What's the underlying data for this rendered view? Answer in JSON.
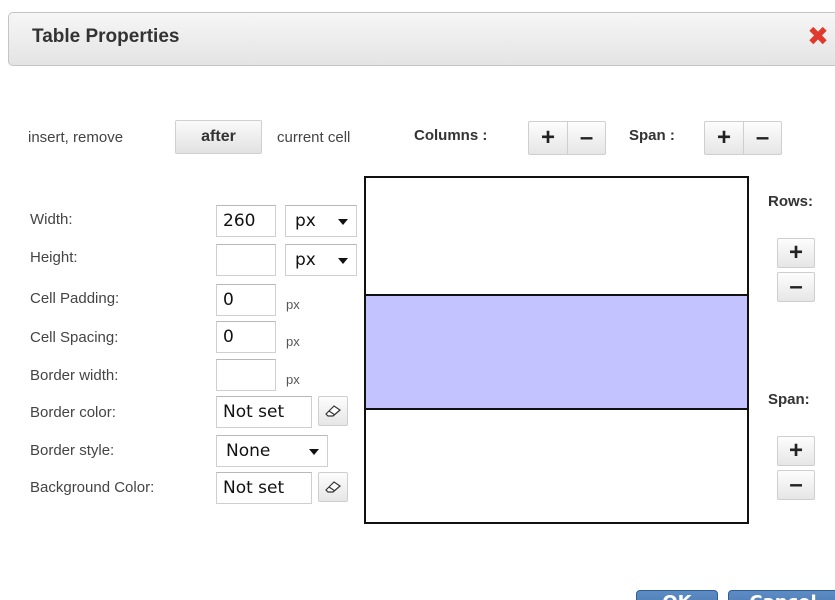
{
  "dialog": {
    "title": "Table Properties",
    "close_icon": "close-icon"
  },
  "cell_bar": {
    "prefix": "insert, remove",
    "after_button": "after",
    "suffix": "current cell",
    "columns_label": "Columns :",
    "span_label": "Span :",
    "plus": "+",
    "minus": "–"
  },
  "fields": {
    "width_label": "Width:",
    "width_value": "260",
    "width_unit": "px",
    "height_label": "Height:",
    "height_value": "",
    "height_unit": "px",
    "cell_padding_label": "Cell Padding:",
    "cell_padding_value": "0",
    "cell_padding_unit": "px",
    "cell_spacing_label": "Cell Spacing:",
    "cell_spacing_value": "0",
    "cell_spacing_unit": "px",
    "border_width_label": "Border width:",
    "border_width_value": "",
    "border_width_unit": "px",
    "border_color_label": "Border color:",
    "border_color_value": "Not set",
    "border_style_label": "Border style:",
    "border_style_value": "None",
    "background_color_label": "Background Color:",
    "background_color_value": "Not set"
  },
  "side": {
    "rows_label": "Rows:",
    "span_label": "Span:",
    "plus": "+",
    "minus": "–"
  },
  "preview": {
    "selected_row_color": "#c3c3ff",
    "border_color": "#111111"
  },
  "actions": {
    "ok": "OK",
    "cancel": "Cancel"
  },
  "colors": {
    "close": "#e03a2e",
    "primary_button": "#4a7bb7"
  }
}
